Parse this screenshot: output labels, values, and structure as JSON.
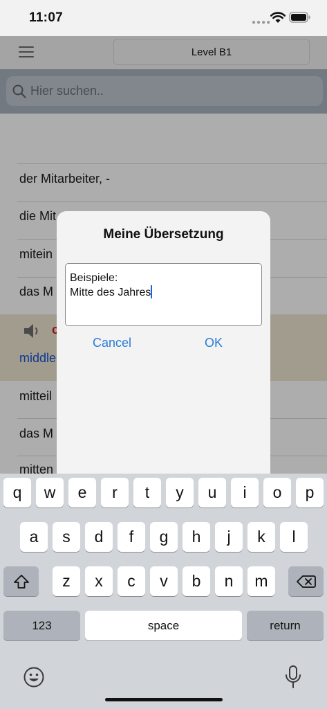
{
  "status": {
    "time": "11:07"
  },
  "header": {
    "level_label": "Level B1"
  },
  "search": {
    "placeholder": "Hier suchen.."
  },
  "list": {
    "rows": [
      "der Mitarbeiter, -",
      "die Mit",
      "mitein",
      "das M",
      "mitteil",
      "das M",
      "mitten"
    ],
    "expanded": {
      "word_fragment": "c",
      "translation_fragment": "middle"
    }
  },
  "dialog": {
    "title": "Meine Übersetzung",
    "text_line1": "Beispiele:",
    "text_line2": "Mitte des Jahres",
    "cancel_label": "Cancel",
    "ok_label": "OK"
  },
  "keyboard": {
    "row1": [
      "q",
      "w",
      "e",
      "r",
      "t",
      "y",
      "u",
      "i",
      "o",
      "p"
    ],
    "row2": [
      "a",
      "s",
      "d",
      "f",
      "g",
      "h",
      "j",
      "k",
      "l"
    ],
    "row3": [
      "z",
      "x",
      "c",
      "v",
      "b",
      "n",
      "m"
    ],
    "numbers_label": "123",
    "space_label": "space",
    "return_label": "return"
  },
  "colors": {
    "accent": "#2a7cd5",
    "highlight_row": "#efe6d2",
    "search_bar": "#a9b3bf"
  }
}
